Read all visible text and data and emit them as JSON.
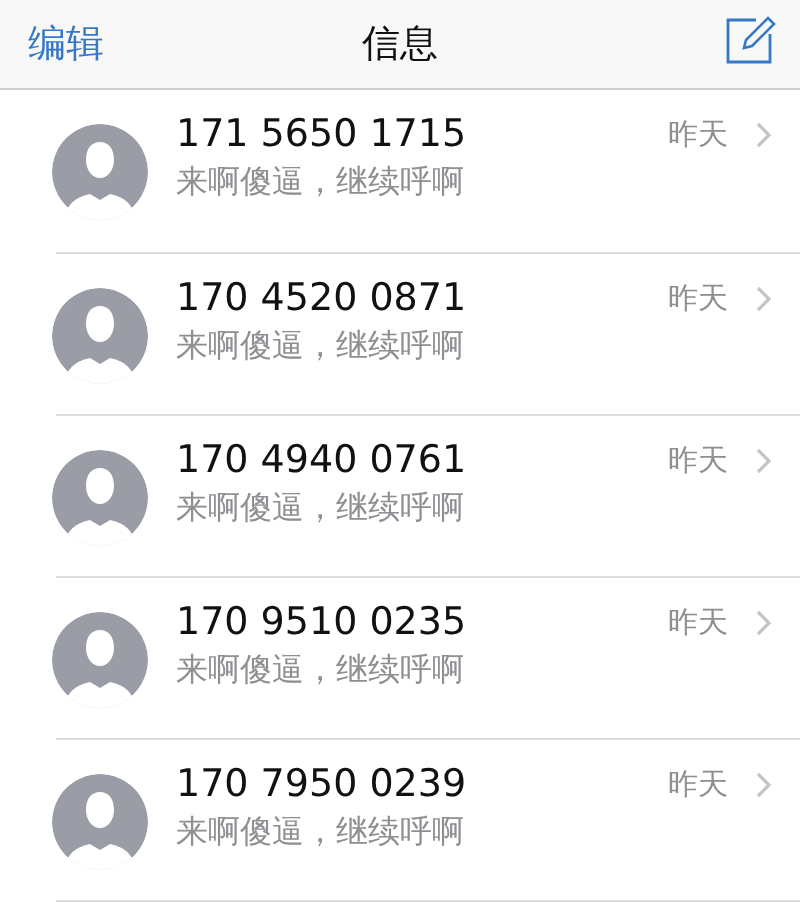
{
  "nav": {
    "left": "编辑",
    "title": "信息"
  },
  "conversations": [
    {
      "sender": "171 5650 1715",
      "preview": "来啊傻逼，继续呼啊",
      "time": "昨天"
    },
    {
      "sender": "170 4520 0871",
      "preview": "来啊傻逼，继续呼啊",
      "time": "昨天"
    },
    {
      "sender": "170 4940 0761",
      "preview": "来啊傻逼，继续呼啊",
      "time": "昨天"
    },
    {
      "sender": "170 9510 0235",
      "preview": "来啊傻逼，继续呼啊",
      "time": "昨天"
    },
    {
      "sender": "170 7950 0239",
      "preview": "来啊傻逼，继续呼啊",
      "time": "昨天"
    }
  ]
}
